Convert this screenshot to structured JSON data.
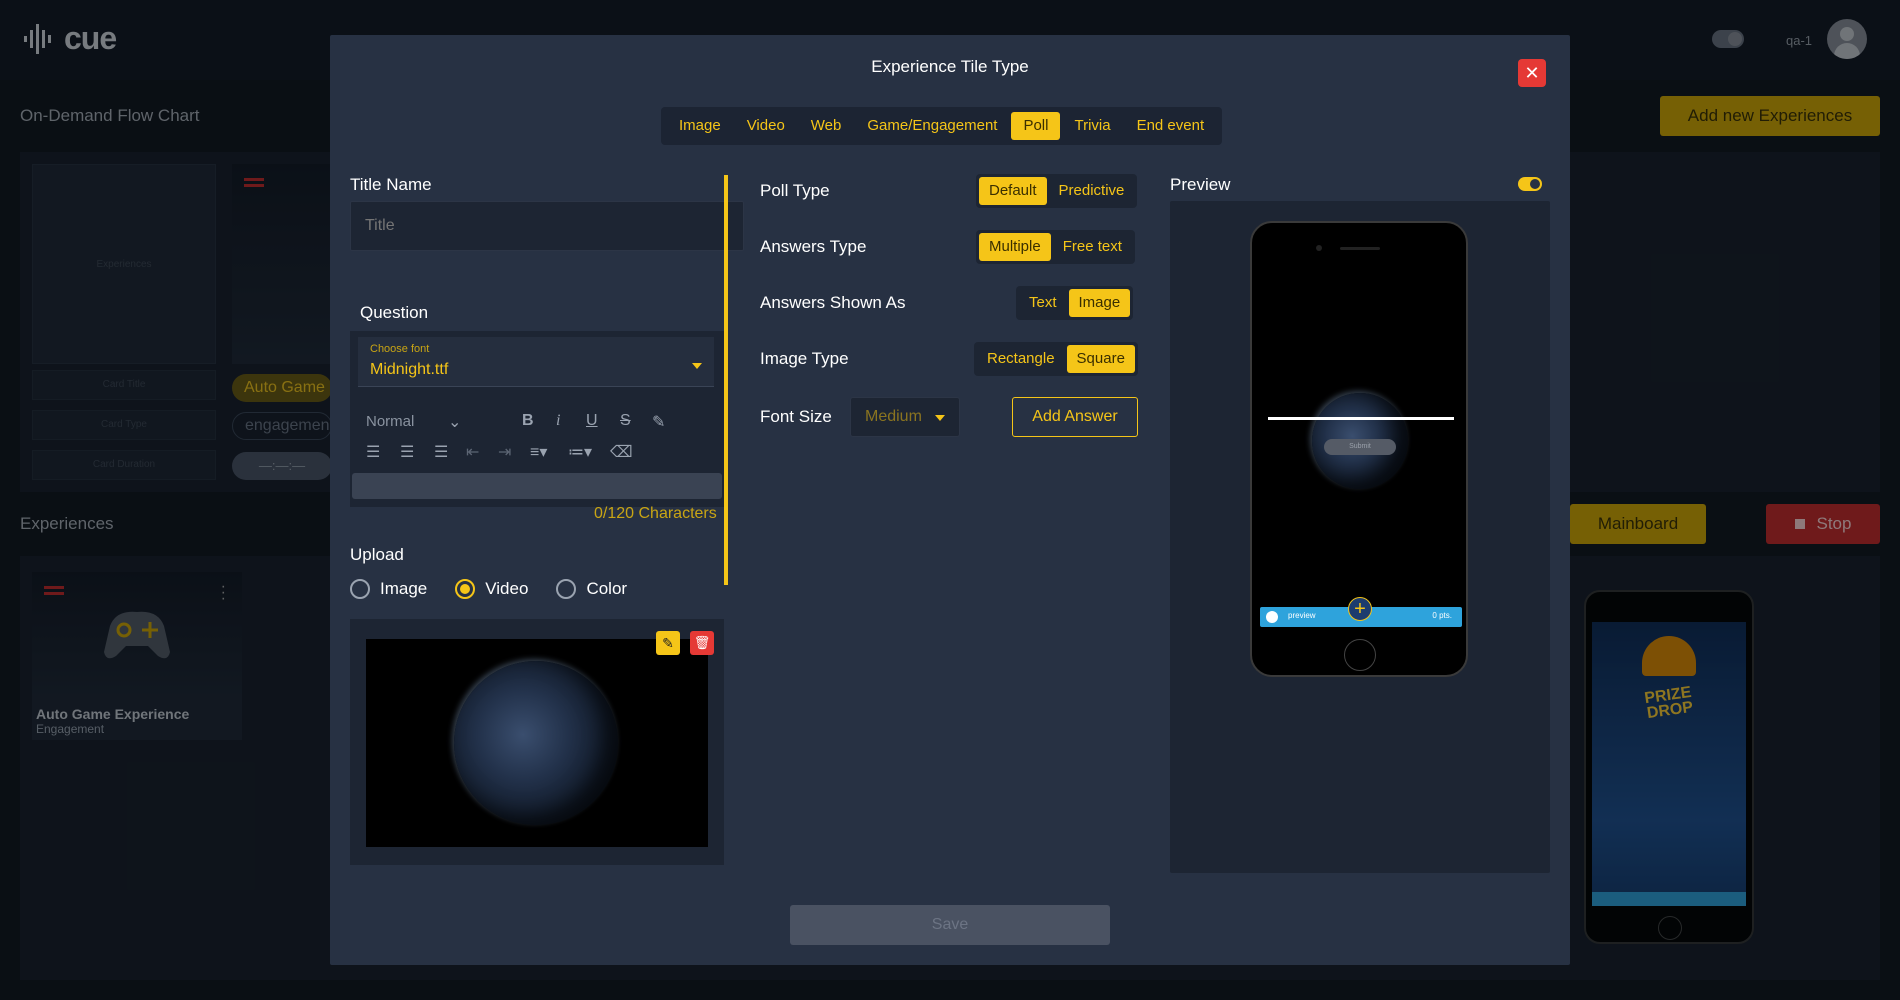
{
  "app": {
    "logo_text": "cue",
    "user": "qa-1"
  },
  "background": {
    "flow_chart_title": "On-Demand Flow Chart",
    "add_new_label": "Add new Experiences",
    "experiences_title": "Experiences",
    "flow_card": {
      "placeholder_label": "Experiences",
      "fields": [
        "Card Title",
        "Card Type",
        "Card Duration"
      ]
    },
    "flow_selected": {
      "title": "Auto Game",
      "type": "engagemen",
      "duration": "—:—:—"
    },
    "mainboard_label": "Mainboard",
    "stop_label": "Stop",
    "experience_card": {
      "title": "Auto Game Experience",
      "type": "Engagement"
    }
  },
  "modal": {
    "title": "Experience Tile Type",
    "tabs": [
      "Image",
      "Video",
      "Web",
      "Game/Engagement",
      "Poll",
      "Trivia",
      "End event"
    ],
    "active_tab": "Poll",
    "title_name_label": "Title Name",
    "title_placeholder": "Title",
    "question_label": "Question",
    "font_label": "Choose font",
    "font_value": "Midnight.ttf",
    "format_value": "Normal",
    "char_count": "0/120 Characters",
    "upload_label": "Upload",
    "upload_options": [
      "Image",
      "Video",
      "Color"
    ],
    "upload_selected": "Video",
    "poll_type": {
      "label": "Poll Type",
      "options": [
        "Default",
        "Predictive"
      ],
      "selected": "Default"
    },
    "answers_type": {
      "label": "Answers Type",
      "options": [
        "Multiple",
        "Free text"
      ],
      "selected": "Multiple"
    },
    "answers_shown": {
      "label": "Answers Shown As",
      "options": [
        "Text",
        "Image"
      ],
      "selected": "Image"
    },
    "image_type": {
      "label": "Image Type",
      "options": [
        "Rectangle",
        "Square"
      ],
      "selected": "Square"
    },
    "font_size": {
      "label": "Font Size",
      "value": "Medium"
    },
    "add_answer_label": "Add Answer",
    "preview_label": "Preview",
    "preview_toggle_on": true,
    "phone": {
      "submit": "Submit",
      "user": "preview",
      "points": "0 pts."
    },
    "save_label": "Save"
  },
  "colors": {
    "accent": "#f5c518",
    "danger": "#e53935",
    "modal_bg": "#273143",
    "phone_bar": "#2ea3dc"
  }
}
